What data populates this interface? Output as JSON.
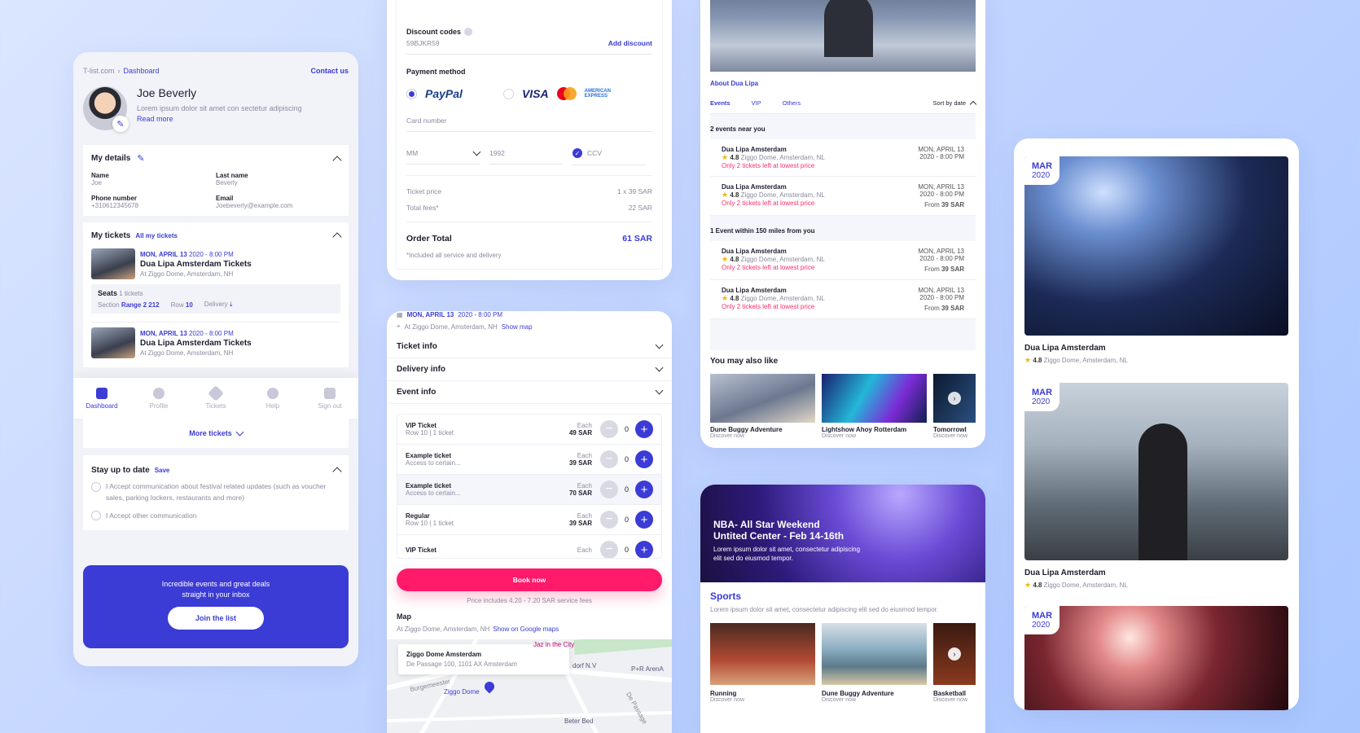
{
  "profile": {
    "breadcrumb_root": "T-list.com",
    "breadcrumb_current": "Dashboard",
    "contact": "Contact us",
    "name": "Joe Beverly",
    "bio": "Lorem ipsum dolor sit amet con sectetur adipiscing",
    "read_more": "Read more",
    "details_title": "My details",
    "fields": {
      "name_label": "Name",
      "name_value": "Joe",
      "last_label": "Last name",
      "last_value": "Beverly",
      "phone_label": "Phone number",
      "phone_value": "+310612345678",
      "email_label": "Email",
      "email_value": "Joebeverly@example.com"
    },
    "tickets_title": "My tickets",
    "all_tickets": "All my tickets",
    "ticket1": {
      "date": "MON, APRIL 13",
      "time": "2020 - 8:00 PM",
      "title": "Dua Lipa Amsterdam Tickets",
      "venue": "At Ziggo Dome, Amsterdam, NH"
    },
    "seats_label": "Seats",
    "seats_count": "1 tickets",
    "section_label": "Section",
    "section_value": "Range 2 212",
    "row_label": "Row",
    "row_value": "10",
    "delivery_label": "Delivery",
    "ticket2": {
      "date": "MON, APRIL 13",
      "time": "2020 - 8:00 PM",
      "title": "Dua Lipa Amsterdam Tickets",
      "venue": "At Ziggo Dome, Amsterdam, NH"
    },
    "nav": [
      "Dashboard",
      "Profile",
      "Tickets",
      "Help",
      "Sign out"
    ],
    "more_tickets": "More tickets",
    "stay_title": "Stay up to date",
    "save": "Save",
    "consent1": "I Accept communication about festival related updates (such as voucher sales, parking lockers, restaurants and more)",
    "consent2": "I Accept other communication",
    "promo_line1": "Incredible events and great deals",
    "promo_line2": "straight in your inbox",
    "join": "Join the list"
  },
  "checkout": {
    "discount_label": "Discount codes",
    "discount_value": "59BJKR59",
    "add_discount": "Add discount",
    "payment_label": "Payment method",
    "paypal": "PayPal",
    "visa": "VISA",
    "amex": "AMERICAN EXPRESS",
    "card_number": "Card number",
    "mm": "MM",
    "year": "1992",
    "ccv": "CCV",
    "ticket_price_label": "Ticket price",
    "ticket_price_value": "1 x 39 SAR",
    "fees_label": "Total fees*",
    "fees_value": "22 SAR",
    "total_label": "Order Total",
    "total_value": "61 SAR",
    "note": "*Included all service and delivery"
  },
  "booking": {
    "date": "MON, APRIL 13",
    "time": "2020 - 8:00 PM",
    "venue": "At Ziggo Dome, Amsterdam, NH",
    "show_map": "Show map",
    "sections": [
      "Ticket info",
      "Delivery info",
      "Event info"
    ],
    "tickets": [
      {
        "name": "VIP Ticket",
        "sub": "Row 10  |  1 ticket",
        "each": "Each",
        "price": "49 SAR",
        "qty": "0"
      },
      {
        "name": "Example ticket",
        "sub": "Access to certain...",
        "each": "Each",
        "price": "39 SAR",
        "qty": "0"
      },
      {
        "name": "Example ticket",
        "sub": "Access to certain...",
        "each": "Each",
        "price": "70 SAR",
        "qty": "0"
      },
      {
        "name": "Regular",
        "sub": "Row 10  |  1 ticket",
        "each": "Each",
        "price": "39 SAR",
        "qty": "0"
      },
      {
        "name": "VIP Ticket",
        "sub": "",
        "each": "Each",
        "price": "",
        "qty": "0"
      }
    ],
    "book_now": "Book now",
    "fees_note": "Price includes 4.20 - 7.20 SAR service fees",
    "map_title": "Map",
    "map_venue": "At Ziggo Dome, Amsterdam, NH",
    "google_maps": "Show on Google maps",
    "map_card_title": "Ziggo Dome Amsterdam",
    "map_card_addr": "De Passage 100, 1101 AX Amsterdam",
    "map_pin": "Ziggo Dome",
    "map_labels": [
      "Jaz in the City",
      "dorf N.V",
      "P+R ArenA",
      "Burgemeester",
      "Beter Bed",
      "De Passage"
    ]
  },
  "events": {
    "about": "About Dua Lipa",
    "tabs": [
      "Events",
      "VIP",
      "Others"
    ],
    "sort": "Sort by date",
    "near_title": "2 events near you",
    "within_title": "1 Event within 150 miles from you",
    "item": {
      "title": "Dua Lipa Amsterdam",
      "rating": "4.8",
      "venue": "Ziggo Dome, Amsterdam, NL",
      "alert": "Only 2 tickets left at lowest price",
      "date": "MON, APRIL 13",
      "time": "2020 - 8:00 PM",
      "from": "From",
      "price": "39 SAR"
    },
    "also_like": "You may also like",
    "recs": [
      {
        "title": "Dune Buggy Adventure",
        "sub": "Discover now"
      },
      {
        "title": "Lightshow Ahoy Rotterdam",
        "sub": "Discover now"
      },
      {
        "title": "Tomorrowl",
        "sub": "Discover now"
      }
    ]
  },
  "sports": {
    "hero_title1": "NBA- All Star Weekend",
    "hero_title2": "Untited Center - Feb 14-16th",
    "hero_body": "Lorem ipsum dolor sit amet, consectetur adipiscing elit sed do eiusmod tempor.",
    "section_title": "Sports",
    "section_body": "Lorem ipsum dolor sit amet, consectetur adipiscing elit sed do eiusmod tempor.",
    "items": [
      {
        "title": "Running",
        "sub": "Discover now"
      },
      {
        "title": "Dune Buggy Adventure",
        "sub": "Discover now"
      },
      {
        "title": "Basketball",
        "sub": "Discover now"
      }
    ]
  },
  "gallery": {
    "items": [
      {
        "month": "MAR",
        "year": "2020",
        "title": "Dua Lipa Amsterdam",
        "rating": "4.8",
        "venue": "Ziggo Dome, Amsterdam, NL"
      },
      {
        "month": "MAR",
        "year": "2020",
        "title": "Dua Lipa Amsterdam",
        "rating": "4.8",
        "venue": "Ziggo Dome, Amsterdam, NL"
      },
      {
        "month": "MAR",
        "year": "2020"
      }
    ]
  }
}
